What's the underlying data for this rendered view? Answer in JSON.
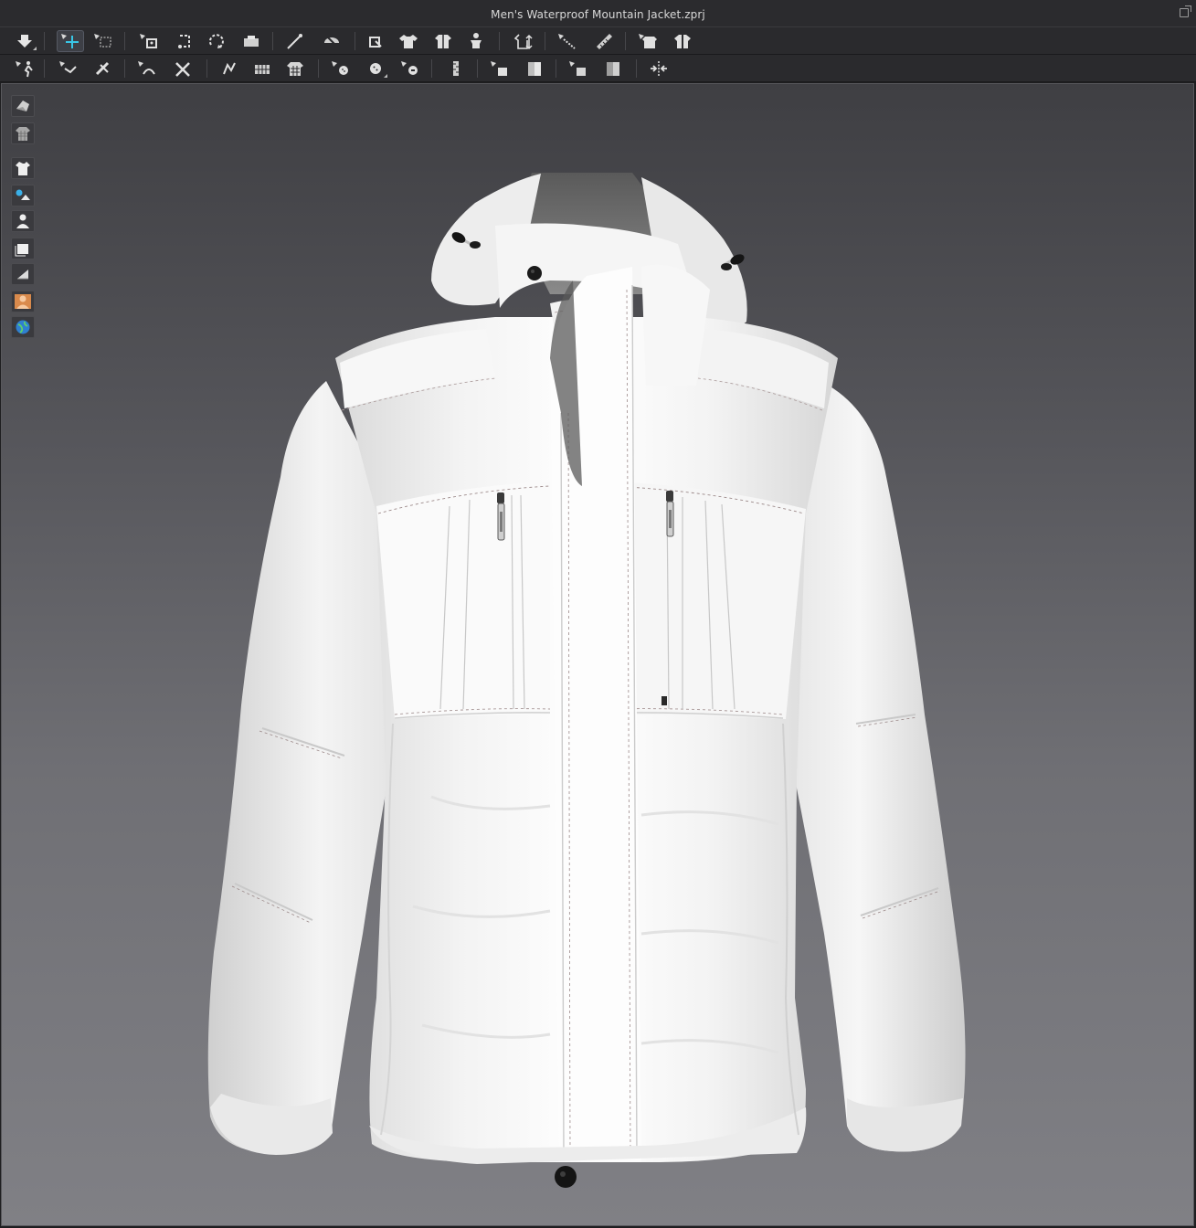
{
  "window": {
    "title": "Men's Waterproof Mountain Jacket.zprj"
  },
  "toolbar_row1": [
    {
      "icon": "import-arrow-icon"
    },
    {
      "icon": "transform-select-icon",
      "active": true
    },
    {
      "icon": "marquee-select-icon"
    },
    {
      "icon": "arrange-point-icon"
    },
    {
      "icon": "arrange-point-2-icon"
    },
    {
      "icon": "rotate-pattern-icon"
    },
    {
      "icon": "flatten-icon"
    },
    {
      "icon": "tack-icon"
    },
    {
      "icon": "steam-icon"
    },
    {
      "icon": "pin-icon"
    },
    {
      "icon": "shirt-symmetric-icon"
    },
    {
      "icon": "shirt-fold-icon"
    },
    {
      "icon": "avatar-fit-icon"
    },
    {
      "icon": "measure-circumference-icon"
    },
    {
      "icon": "measure-length-icon"
    },
    {
      "icon": "tape-ruler-icon"
    },
    {
      "icon": "shirt-layer-icon"
    },
    {
      "icon": "shirt-unlayer-icon"
    }
  ],
  "toolbar_row2": [
    {
      "icon": "avatar-pose-icon"
    },
    {
      "icon": "arrangement-icon"
    },
    {
      "icon": "select-move-pin-icon"
    },
    {
      "icon": "sew-line-icon"
    },
    {
      "icon": "sew-segment-icon"
    },
    {
      "icon": "fold-arrange-icon"
    },
    {
      "icon": "fold-grid-icon"
    },
    {
      "icon": "texture-grid-icon"
    },
    {
      "icon": "button-tool-icon"
    },
    {
      "icon": "button-icon"
    },
    {
      "icon": "buttonhole-icon"
    },
    {
      "icon": "zipper-icon"
    },
    {
      "icon": "puckering-icon"
    },
    {
      "icon": "tape-icon"
    },
    {
      "icon": "elastic-icon"
    },
    {
      "icon": "topstitch-icon"
    },
    {
      "icon": "move-anchor-icon"
    }
  ],
  "side_tools": [
    {
      "icon": "show-garment-icon"
    },
    {
      "icon": "garment-texture-icon"
    },
    {
      "icon": "show-3d-garment-icon"
    },
    {
      "icon": "show-pins-icon"
    },
    {
      "icon": "show-avatar-icon"
    },
    {
      "icon": "show-pattern-icon"
    },
    {
      "icon": "display-mode-icon"
    },
    {
      "icon": "skin-avatar-icon"
    },
    {
      "icon": "environment-globe-icon"
    }
  ]
}
